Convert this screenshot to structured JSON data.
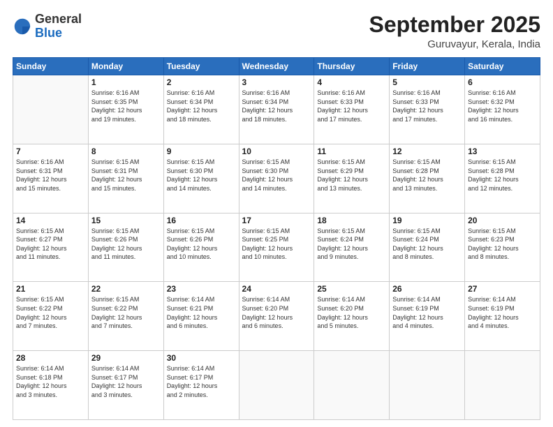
{
  "header": {
    "logo_general": "General",
    "logo_blue": "Blue",
    "month": "September 2025",
    "location": "Guruvayur, Kerala, India"
  },
  "days_of_week": [
    "Sunday",
    "Monday",
    "Tuesday",
    "Wednesday",
    "Thursday",
    "Friday",
    "Saturday"
  ],
  "weeks": [
    [
      {
        "day": "",
        "info": ""
      },
      {
        "day": "1",
        "info": "Sunrise: 6:16 AM\nSunset: 6:35 PM\nDaylight: 12 hours\nand 19 minutes."
      },
      {
        "day": "2",
        "info": "Sunrise: 6:16 AM\nSunset: 6:34 PM\nDaylight: 12 hours\nand 18 minutes."
      },
      {
        "day": "3",
        "info": "Sunrise: 6:16 AM\nSunset: 6:34 PM\nDaylight: 12 hours\nand 18 minutes."
      },
      {
        "day": "4",
        "info": "Sunrise: 6:16 AM\nSunset: 6:33 PM\nDaylight: 12 hours\nand 17 minutes."
      },
      {
        "day": "5",
        "info": "Sunrise: 6:16 AM\nSunset: 6:33 PM\nDaylight: 12 hours\nand 17 minutes."
      },
      {
        "day": "6",
        "info": "Sunrise: 6:16 AM\nSunset: 6:32 PM\nDaylight: 12 hours\nand 16 minutes."
      }
    ],
    [
      {
        "day": "7",
        "info": "Sunrise: 6:16 AM\nSunset: 6:31 PM\nDaylight: 12 hours\nand 15 minutes."
      },
      {
        "day": "8",
        "info": "Sunrise: 6:15 AM\nSunset: 6:31 PM\nDaylight: 12 hours\nand 15 minutes."
      },
      {
        "day": "9",
        "info": "Sunrise: 6:15 AM\nSunset: 6:30 PM\nDaylight: 12 hours\nand 14 minutes."
      },
      {
        "day": "10",
        "info": "Sunrise: 6:15 AM\nSunset: 6:30 PM\nDaylight: 12 hours\nand 14 minutes."
      },
      {
        "day": "11",
        "info": "Sunrise: 6:15 AM\nSunset: 6:29 PM\nDaylight: 12 hours\nand 13 minutes."
      },
      {
        "day": "12",
        "info": "Sunrise: 6:15 AM\nSunset: 6:28 PM\nDaylight: 12 hours\nand 13 minutes."
      },
      {
        "day": "13",
        "info": "Sunrise: 6:15 AM\nSunset: 6:28 PM\nDaylight: 12 hours\nand 12 minutes."
      }
    ],
    [
      {
        "day": "14",
        "info": "Sunrise: 6:15 AM\nSunset: 6:27 PM\nDaylight: 12 hours\nand 11 minutes."
      },
      {
        "day": "15",
        "info": "Sunrise: 6:15 AM\nSunset: 6:26 PM\nDaylight: 12 hours\nand 11 minutes."
      },
      {
        "day": "16",
        "info": "Sunrise: 6:15 AM\nSunset: 6:26 PM\nDaylight: 12 hours\nand 10 minutes."
      },
      {
        "day": "17",
        "info": "Sunrise: 6:15 AM\nSunset: 6:25 PM\nDaylight: 12 hours\nand 10 minutes."
      },
      {
        "day": "18",
        "info": "Sunrise: 6:15 AM\nSunset: 6:24 PM\nDaylight: 12 hours\nand 9 minutes."
      },
      {
        "day": "19",
        "info": "Sunrise: 6:15 AM\nSunset: 6:24 PM\nDaylight: 12 hours\nand 8 minutes."
      },
      {
        "day": "20",
        "info": "Sunrise: 6:15 AM\nSunset: 6:23 PM\nDaylight: 12 hours\nand 8 minutes."
      }
    ],
    [
      {
        "day": "21",
        "info": "Sunrise: 6:15 AM\nSunset: 6:22 PM\nDaylight: 12 hours\nand 7 minutes."
      },
      {
        "day": "22",
        "info": "Sunrise: 6:15 AM\nSunset: 6:22 PM\nDaylight: 12 hours\nand 7 minutes."
      },
      {
        "day": "23",
        "info": "Sunrise: 6:14 AM\nSunset: 6:21 PM\nDaylight: 12 hours\nand 6 minutes."
      },
      {
        "day": "24",
        "info": "Sunrise: 6:14 AM\nSunset: 6:20 PM\nDaylight: 12 hours\nand 6 minutes."
      },
      {
        "day": "25",
        "info": "Sunrise: 6:14 AM\nSunset: 6:20 PM\nDaylight: 12 hours\nand 5 minutes."
      },
      {
        "day": "26",
        "info": "Sunrise: 6:14 AM\nSunset: 6:19 PM\nDaylight: 12 hours\nand 4 minutes."
      },
      {
        "day": "27",
        "info": "Sunrise: 6:14 AM\nSunset: 6:19 PM\nDaylight: 12 hours\nand 4 minutes."
      }
    ],
    [
      {
        "day": "28",
        "info": "Sunrise: 6:14 AM\nSunset: 6:18 PM\nDaylight: 12 hours\nand 3 minutes."
      },
      {
        "day": "29",
        "info": "Sunrise: 6:14 AM\nSunset: 6:17 PM\nDaylight: 12 hours\nand 3 minutes."
      },
      {
        "day": "30",
        "info": "Sunrise: 6:14 AM\nSunset: 6:17 PM\nDaylight: 12 hours\nand 2 minutes."
      },
      {
        "day": "",
        "info": ""
      },
      {
        "day": "",
        "info": ""
      },
      {
        "day": "",
        "info": ""
      },
      {
        "day": "",
        "info": ""
      }
    ]
  ]
}
